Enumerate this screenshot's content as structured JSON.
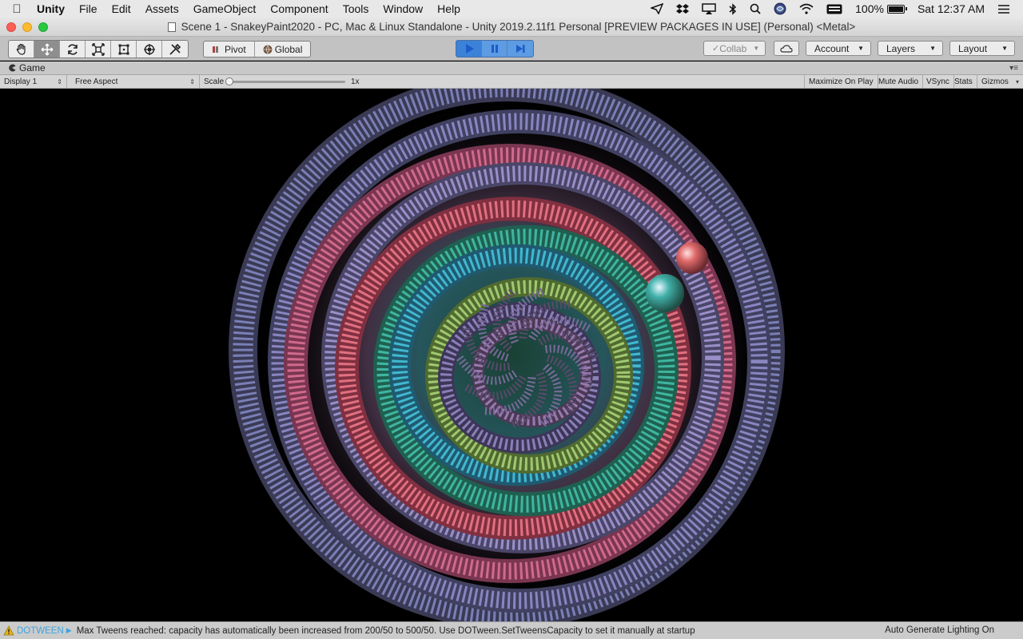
{
  "menubar": {
    "app": "Unity",
    "menus": [
      "File",
      "Edit",
      "Assets",
      "GameObject",
      "Component",
      "Tools",
      "Window",
      "Help"
    ],
    "tray": {
      "battery_percent": "100%",
      "battery_level": 1.0,
      "clock": "Sat 12:37 AM",
      "icons": [
        "paper-plane-icon",
        "dropbox-icon",
        "airplay-icon",
        "bluetooth-icon",
        "spotlight-icon",
        "siri-icon",
        "wifi-icon",
        "keyboard-icon",
        "control-center-icon"
      ]
    }
  },
  "window": {
    "title": "Scene 1 - SnakeyPaint2020 - PC, Mac & Linux Standalone - Unity 2019.2.11f1 Personal [PREVIEW PACKAGES IN USE] (Personal) <Metal>"
  },
  "toolbar": {
    "tools": [
      "hand-tool-icon",
      "move-tool-icon",
      "rotate-tool-icon",
      "scale-tool-icon",
      "rect-tool-icon",
      "transform-tool-icon",
      "custom-tool-icon"
    ],
    "active_tool": "move",
    "pivot_label": "Pivot",
    "global_label": "Global",
    "collab_label": "Collab",
    "account_label": "Account",
    "layers_label": "Layers",
    "layout_label": "Layout",
    "accent_color": "#2f7ddb"
  },
  "game": {
    "tab_label": "Game",
    "display": "Display 1",
    "aspect": "Free Aspect",
    "scale_label": "Scale",
    "scale_value": "1x",
    "toggles": {
      "maximize": "Maximize On Play",
      "mute": "Mute Audio",
      "vsync": "VSync",
      "stats": "Stats",
      "gizmos": "Gizmos"
    }
  },
  "status": {
    "tag": "DOTWEEN",
    "message": "Max Tweens reached: capacity has automatically been increased from 200/50 to 500/50. Use DOTween.SetTweensCapacity to set it manually at startup",
    "right": "Auto Generate Lighting On"
  }
}
